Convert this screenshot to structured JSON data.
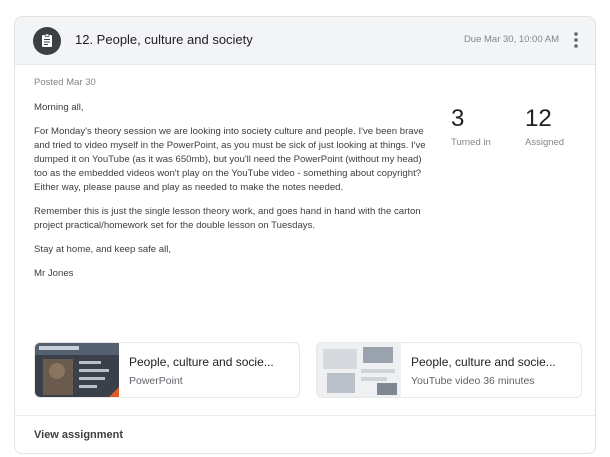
{
  "header": {
    "title": "12. People, culture and society",
    "due": "Due Mar 30, 10:00 AM",
    "assignment_icon": "assignment-icon",
    "more_icon": "more-vert-icon"
  },
  "posted": "Posted Mar 30",
  "body": {
    "greeting": "Morning all,",
    "paragraph1": "For Monday's theory session we are looking into society culture and people. I've been brave and tried to video myself in the PowerPoint, as you must be sick of just looking at things. I've dumped it on YouTube (as it was 650mb), but you'll need the PowerPoint (without my head) too as the embedded videos won't play on the YouTube video - something about copyright? Either way, please pause and play as needed to make the notes needed.",
    "paragraph2": "Remember this is just the single lesson theory work, and goes hand in hand with the carton project practical/homework set for the double lesson on Tuesdays.",
    "paragraph3": "Stay at home, and keep safe all,",
    "signature": "Mr Jones"
  },
  "stats": {
    "turned_in_count": "3",
    "turned_in_label": "Turned in",
    "assigned_count": "12",
    "assigned_label": "Assigned"
  },
  "attachments": [
    {
      "name": "People, culture and socie...",
      "meta": "PowerPoint"
    },
    {
      "name": "People, culture and socie...",
      "meta": "YouTube video   36 minutes"
    }
  ],
  "footer": {
    "view_label": "View assignment"
  },
  "colors": {
    "header_bg": "#f3f4f6",
    "icon_bg": "#3c4043",
    "text": "#3c4043",
    "muted": "#80868b"
  }
}
